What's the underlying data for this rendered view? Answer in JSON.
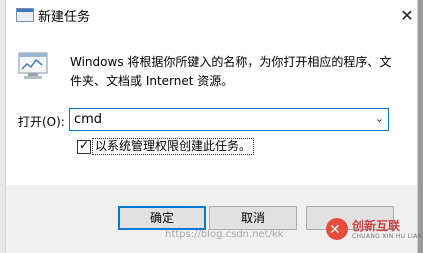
{
  "dialog": {
    "title": "新建任务",
    "close_glyph": "✕",
    "description": "Windows 将根据你所键入的名称，为你打开相应的程序、文件夹、文档或 Internet 资源。"
  },
  "open_field": {
    "label": "打开(O):",
    "value": "cmd",
    "dropdown_glyph": "⌄"
  },
  "admin_checkbox": {
    "checked": true,
    "label": "以系统管理权限创建此任务。"
  },
  "buttons": {
    "ok": "确定",
    "cancel": "取消",
    "browse": ""
  },
  "watermark": {
    "url_text": "https://blog.csdn.net/kk",
    "logo_title": "创新互联",
    "logo_subtitle": "CHUANG XIN HU LIAN"
  },
  "colors": {
    "accent": "#0078d7",
    "footer_bg": "#f0f0f0",
    "logo": "#e84c3d"
  }
}
